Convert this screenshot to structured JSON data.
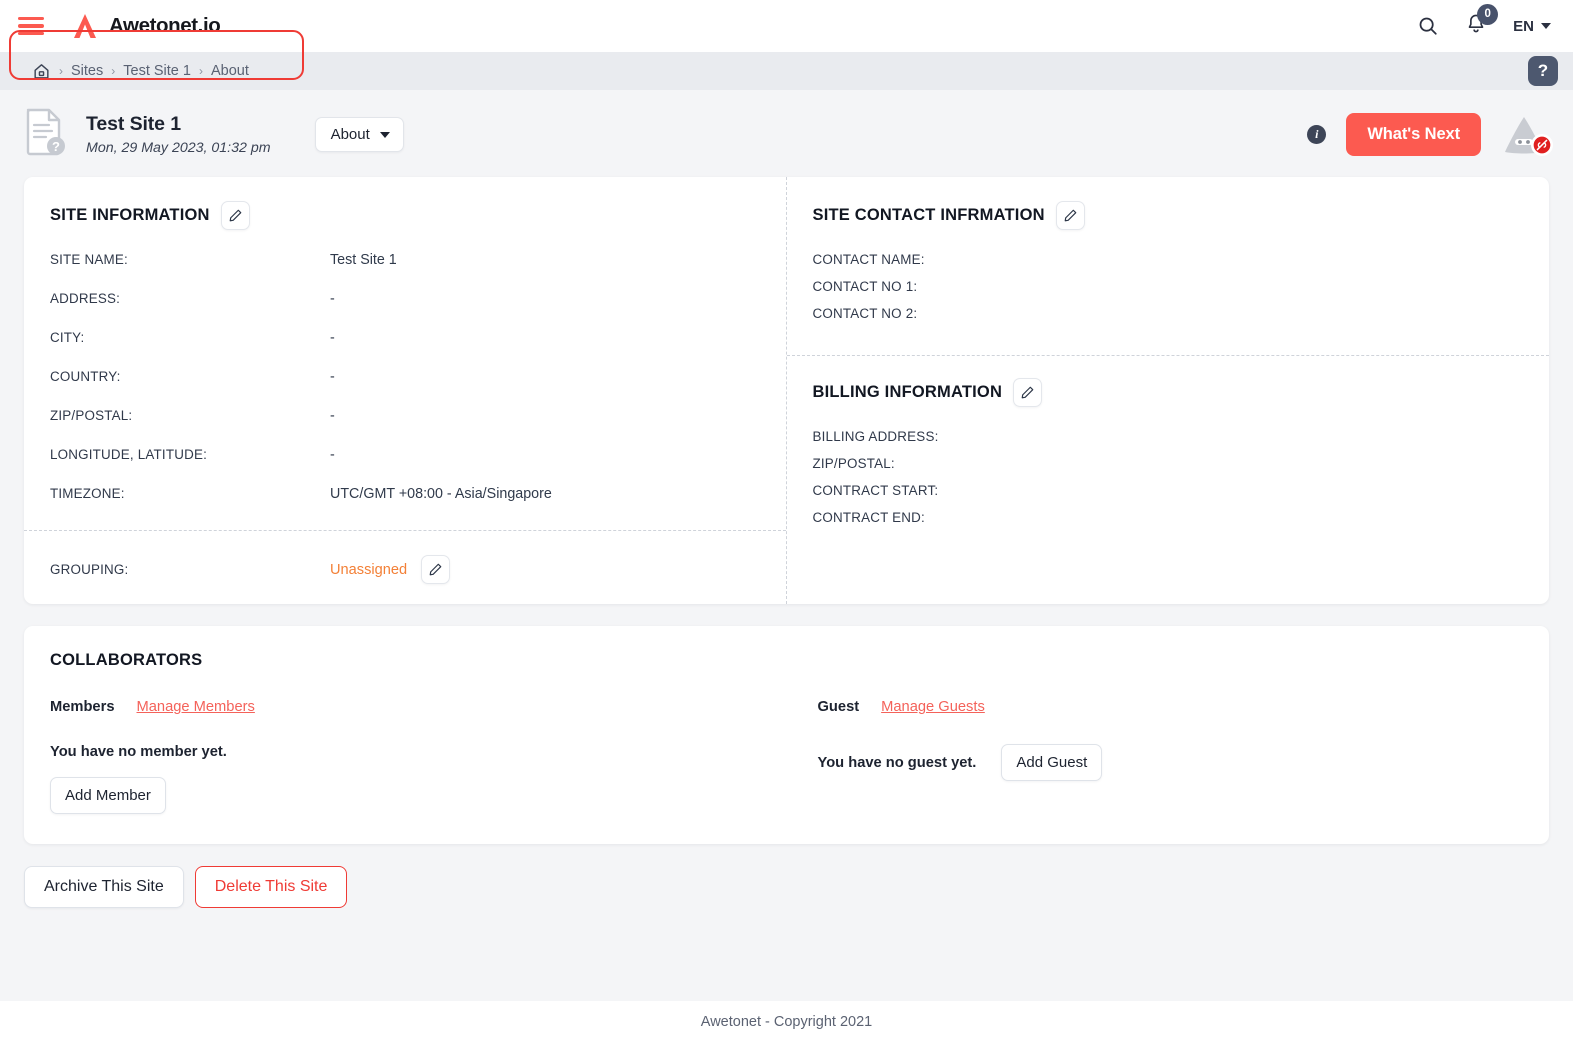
{
  "topbar": {
    "menu_icon": "hamburger-menu-icon",
    "brand_name": "Awetonet.io",
    "search_icon": "search-icon",
    "bell_icon": "bell-icon",
    "notification_count": "0",
    "language": "EN"
  },
  "breadcrumb": {
    "home_icon": "home-icon",
    "separator": "›",
    "items": [
      {
        "label": "Sites"
      },
      {
        "label": "Test Site 1"
      },
      {
        "label": "About"
      }
    ],
    "help_label": "?"
  },
  "pagehead": {
    "doc_icon": "document-question-icon",
    "title": "Test Site 1",
    "subtitle": "Mon, 29 May 2023, 01:32 pm",
    "view_selector": "About",
    "info_icon": "info-icon",
    "whats_next": "What's Next",
    "avatar_icon": "ninja-avatar-icon",
    "avatar_badge_icon": "link-off-icon"
  },
  "site_information": {
    "title": "SITE INFORMATION",
    "edit_icon": "pencil-icon",
    "fields": [
      {
        "label": "SITE NAME:",
        "value": "Test Site 1"
      },
      {
        "label": "ADDRESS:",
        "value": "-"
      },
      {
        "label": "CITY:",
        "value": "-"
      },
      {
        "label": "COUNTRY:",
        "value": "-"
      },
      {
        "label": "ZIP/POSTAL:",
        "value": "-"
      },
      {
        "label": "LONGITUDE, LATITUDE:",
        "value": "-"
      },
      {
        "label": "TIMEZONE:",
        "value": "UTC/GMT +08:00 - Asia/Singapore"
      }
    ],
    "grouping": {
      "label": "GROUPING:",
      "value": "Unassigned",
      "value_color": "#f38037",
      "edit_icon": "pencil-icon"
    }
  },
  "site_contact_information": {
    "title": "SITE CONTACT INFRMATION",
    "edit_icon": "pencil-icon",
    "fields": [
      {
        "label": "CONTACT NAME:",
        "value": ""
      },
      {
        "label": "CONTACT NO 1:",
        "value": ""
      },
      {
        "label": "CONTACT NO 2:",
        "value": ""
      }
    ]
  },
  "billing_information": {
    "title": "BILLING INFORMATION",
    "edit_icon": "pencil-icon",
    "fields": [
      {
        "label": "BILLING ADDRESS:",
        "value": ""
      },
      {
        "label": "ZIP/POSTAL:",
        "value": ""
      },
      {
        "label": "CONTRACT START:",
        "value": ""
      },
      {
        "label": "CONTRACT END:",
        "value": ""
      }
    ]
  },
  "collaborators": {
    "title": "COLLABORATORS",
    "members": {
      "kind": "Members",
      "manage_link": "Manage Members",
      "empty_text": "You have no member yet.",
      "add_button": "Add Member"
    },
    "guests": {
      "kind": "Guest",
      "manage_link": "Manage Guests",
      "empty_text": "You have no guest yet.",
      "add_button": "Add Guest"
    }
  },
  "bottom_actions": {
    "archive": "Archive This Site",
    "delete": "Delete This Site"
  },
  "footer": {
    "text": "Awetonet - Copyright 2021"
  },
  "colors": {
    "brand_red": "#fc5a50",
    "highlight_red": "#ef3b35",
    "link_red": "#f4625a",
    "accent_orange": "#f38037",
    "badge_slate": "#48526b",
    "page_bg": "#f4f5f7"
  }
}
